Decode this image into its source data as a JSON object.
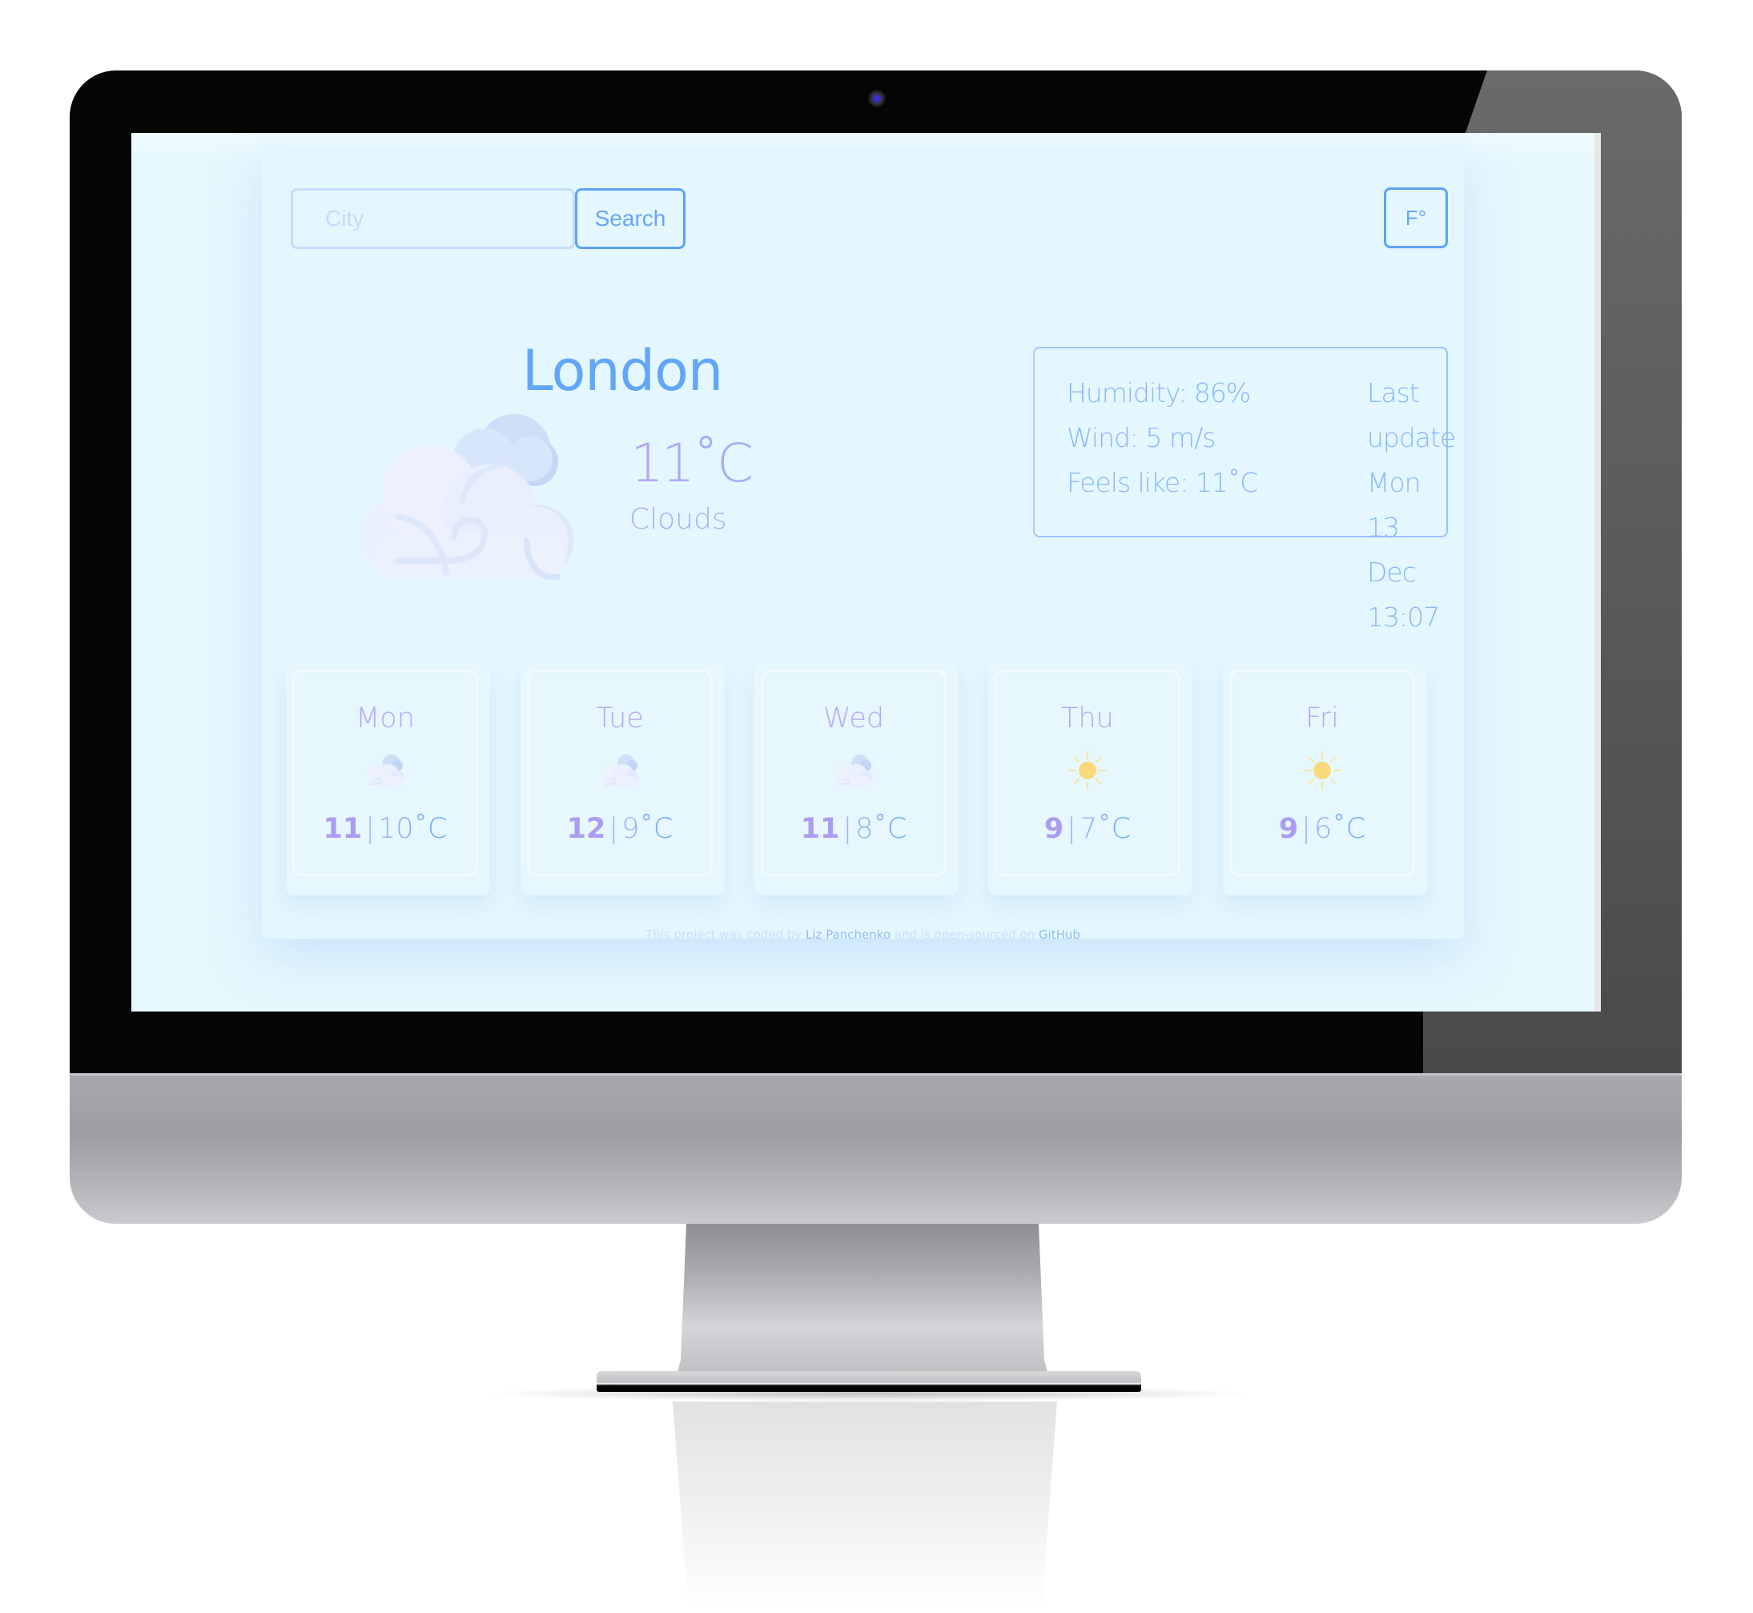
{
  "search": {
    "placeholder": "City",
    "value": "",
    "button_label": "Search"
  },
  "unit_toggle": {
    "label": "F°"
  },
  "current": {
    "city": "London",
    "temperature": "11",
    "unit": "˚C",
    "description": "Clouds",
    "icon": "clouds-wind-icon"
  },
  "details": {
    "humidity": "Humidity: 86%",
    "wind": "Wind: 5 m/s",
    "feels_like": "Feels like: 11˚C",
    "last_update_label": "Last update",
    "last_update_date": "Mon 13 Dec",
    "last_update_time": "13:07"
  },
  "forecast": [
    {
      "day": "Mon",
      "icon": "clouds-icon",
      "max": "11",
      "min": "10˚C"
    },
    {
      "day": "Tue",
      "icon": "clouds-icon",
      "max": "12",
      "min": "9˚C"
    },
    {
      "day": "Wed",
      "icon": "clouds-icon",
      "max": "11",
      "min": "8˚C"
    },
    {
      "day": "Thu",
      "icon": "sun-icon",
      "max": "9",
      "min": "7˚C"
    },
    {
      "day": "Fri",
      "icon": "sun-icon",
      "max": "9",
      "min": "6˚C"
    }
  ],
  "forecast_separator": "|",
  "footer": {
    "prefix": "This project was coded by ",
    "author_link": "Liz Panchenko",
    "middle": " and is open-sourced on ",
    "repo_link": "GitHub"
  },
  "colors": {
    "accent_blue": "#62a6f8",
    "accent_purple": "#b9a8f2",
    "background": "#e6f8fe",
    "sun": "#fbd97a"
  }
}
